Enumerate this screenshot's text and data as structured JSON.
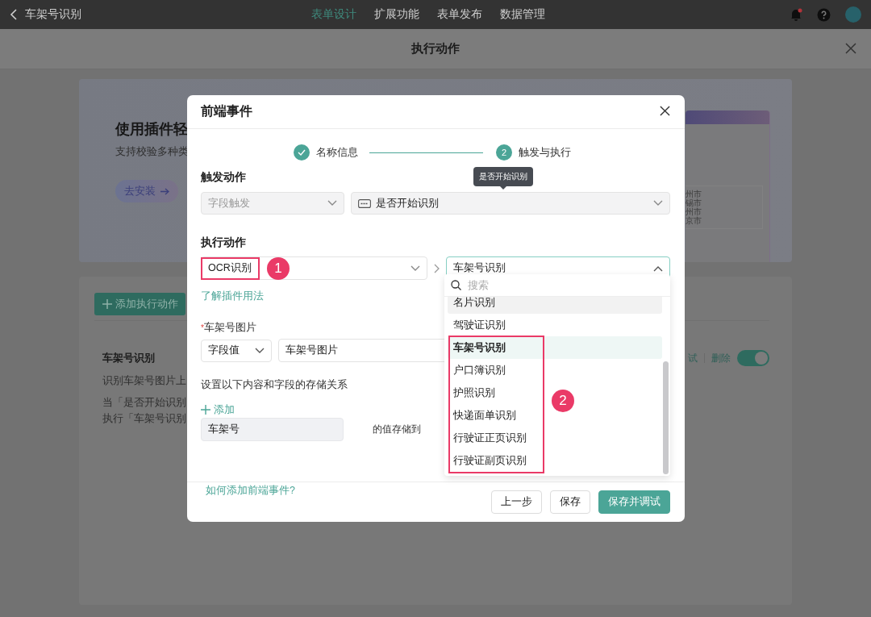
{
  "app_bar": {
    "title": "车架号识别",
    "tabs": [
      {
        "label": "表单设计",
        "selected": true
      },
      {
        "label": "扩展功能",
        "selected": false
      },
      {
        "label": "表单发布",
        "selected": false
      },
      {
        "label": "数据管理",
        "selected": false
      }
    ]
  },
  "page_header": {
    "title": "执行动作"
  },
  "banner": {
    "title": "使用插件轻",
    "subtitle": "支持校验多种类",
    "install_button": "去安装",
    "preview_lines": [
      "州市",
      "锡市",
      "州市",
      "京市"
    ]
  },
  "actions_panel": {
    "add_button": "添加执行动作",
    "action": {
      "title": "车架号识别",
      "description": [
        "识别车架号图片上",
        "当「是否开始识别",
        "执行「车架号识别"
      ],
      "debug_link": "试",
      "delete_link": "删除",
      "enabled": true
    }
  },
  "dialog": {
    "title": "前端事件",
    "steps": [
      {
        "label": "名称信息",
        "done": true
      },
      {
        "label": "触发与执行",
        "number": "2",
        "done": false
      }
    ],
    "tooltip": "是否开始识别",
    "trigger": {
      "label": "触发动作",
      "type_select": {
        "value": "字段触发",
        "disabled": true
      },
      "field_select": {
        "value": "是否开始识别"
      }
    },
    "execute": {
      "label": "执行动作",
      "plugin_select": {
        "value": "OCR识别"
      },
      "action_select": {
        "value": "车架号识别",
        "expanded": true
      },
      "help_link": "了解插件用法"
    },
    "params": [
      {
        "label": "车架号图片",
        "required_mark": "*",
        "mode": "字段值",
        "value": "车架号图片"
      }
    ],
    "mapping": {
      "label": "设置以下内容和字段的存储关系",
      "add_button": "添加",
      "rows": [
        {
          "source": "车架号",
          "connector": "的值存储到"
        }
      ]
    },
    "dropdown": {
      "placeholder": "搜索",
      "options": [
        {
          "label": "名片识别",
          "selected": false,
          "hovered": true
        },
        {
          "label": "驾驶证识别",
          "selected": false,
          "hovered": false
        },
        {
          "label": "车架号识别",
          "selected": true,
          "hovered": false
        },
        {
          "label": "户口簿识别",
          "selected": false,
          "hovered": false
        },
        {
          "label": "护照识别",
          "selected": false,
          "hovered": false
        },
        {
          "label": "快递面单识别",
          "selected": false,
          "hovered": false
        },
        {
          "label": "行驶证正页识别",
          "selected": false,
          "hovered": false
        },
        {
          "label": "行驶证副页识别",
          "selected": false,
          "hovered": false
        }
      ]
    },
    "footer": {
      "help_link": "如何添加前端事件?",
      "buttons": [
        {
          "label": "上一步",
          "kind": "default"
        },
        {
          "label": "保存",
          "kind": "default"
        },
        {
          "label": "保存并调试",
          "kind": "primary"
        }
      ]
    }
  },
  "annotations": [
    {
      "number": "1"
    },
    {
      "number": "2"
    }
  ]
}
